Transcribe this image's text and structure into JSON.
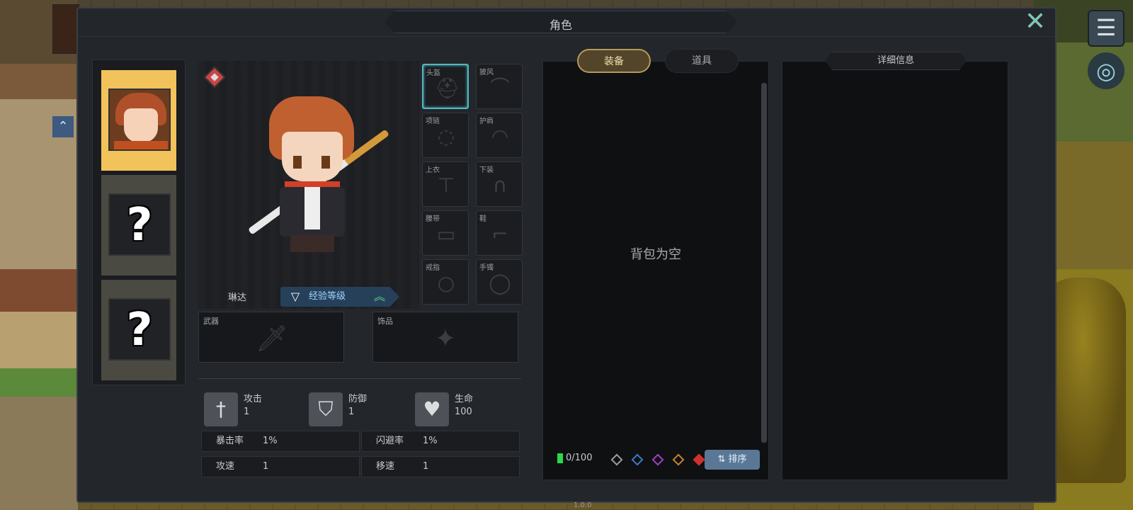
{
  "window": {
    "title": "角色"
  },
  "character_slots": [
    {
      "state": "active"
    },
    {
      "state": "locked",
      "label": "?"
    },
    {
      "state": "locked",
      "label": "?"
    }
  ],
  "character": {
    "name": "琳达",
    "level_text": "经验等级",
    "level_up_icon": "double-chevron-up-icon"
  },
  "equipment": {
    "slots": [
      {
        "label": "头盔",
        "icon": "helmet-icon"
      },
      {
        "label": "披风",
        "icon": "cape-icon"
      },
      {
        "label": "项链",
        "icon": "necklace-icon"
      },
      {
        "label": "护肩",
        "icon": "pauldron-icon"
      },
      {
        "label": "上衣",
        "icon": "shirt-icon"
      },
      {
        "label": "下装",
        "icon": "pants-icon"
      },
      {
        "label": "腰带",
        "icon": "belt-icon"
      },
      {
        "label": "鞋",
        "icon": "boot-icon"
      },
      {
        "label": "戒指",
        "icon": "ring-icon"
      },
      {
        "label": "手镯",
        "icon": "bracelet-icon"
      }
    ],
    "weapon": {
      "label": "武器",
      "icon": "sword-icon"
    },
    "accessory": {
      "label": "饰品",
      "icon": "compass-icon"
    }
  },
  "stats": {
    "primary": [
      {
        "name": "攻击",
        "value": "1",
        "icon": "sword-icon"
      },
      {
        "name": "防御",
        "value": "1",
        "icon": "shield-icon"
      },
      {
        "name": "生命",
        "value": "100",
        "icon": "heart-plus-icon"
      }
    ],
    "secondary": [
      {
        "key": "暴击率",
        "value": "1%"
      },
      {
        "key": "闪避率",
        "value": "1%"
      },
      {
        "key": "攻速",
        "value": "1"
      },
      {
        "key": "移速",
        "value": "1"
      }
    ]
  },
  "inventory": {
    "tabs": [
      "装备",
      "道具"
    ],
    "active_tab": 0,
    "empty_message": "背包为空",
    "filter_count": "0/100",
    "rarity_colors": [
      "#9a9ca0",
      "#3a7ac8",
      "#a040c0",
      "#c88030",
      "#d03030"
    ],
    "sort_label": "排序"
  },
  "detail": {
    "title": "详细信息"
  },
  "footer": {
    "text": "1.0.0"
  }
}
